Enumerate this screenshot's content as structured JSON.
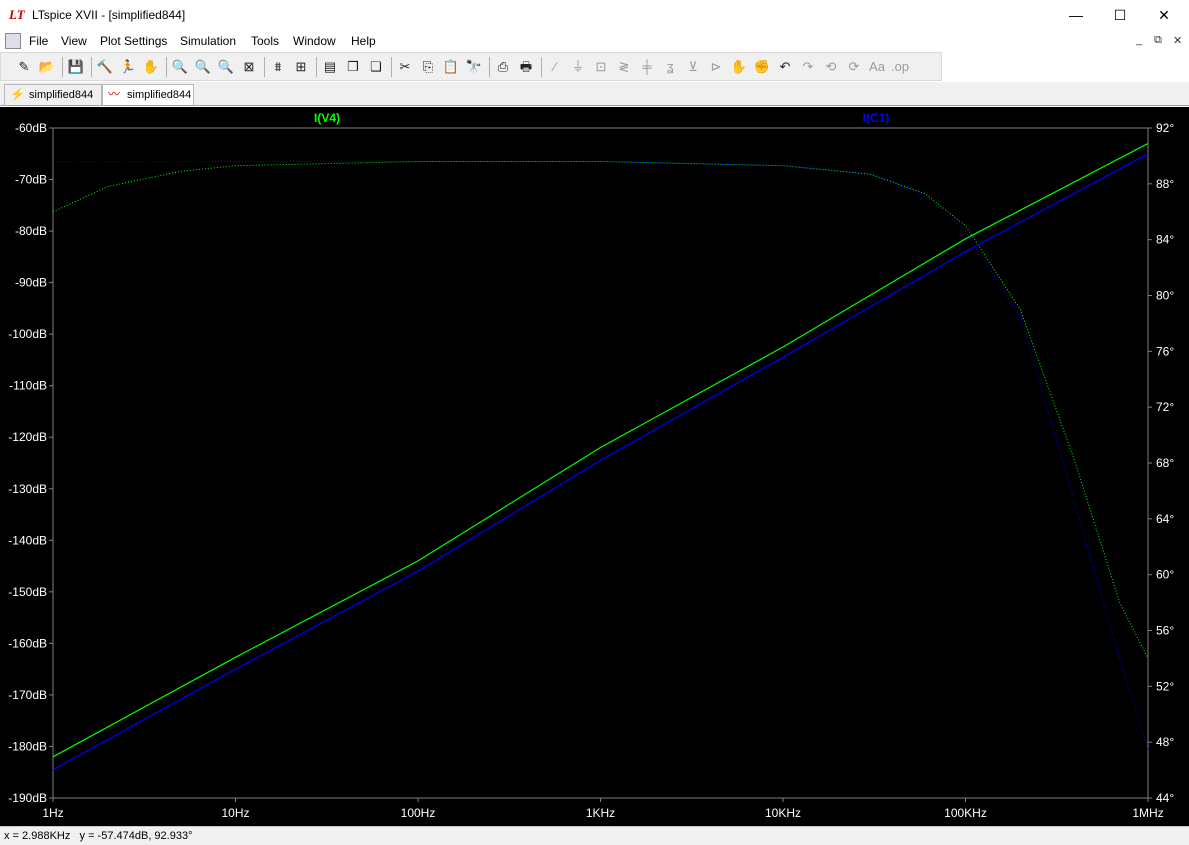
{
  "window": {
    "title": "LTspice XVII - [simplified844]",
    "app_icon": "LT",
    "controls": {
      "minimize": "—",
      "maximize": "☐",
      "close": "✕"
    }
  },
  "menu": {
    "items": [
      "File",
      "View",
      "Plot Settings",
      "Simulation",
      "Tools",
      "Window",
      "Help"
    ],
    "mdi_controls": {
      "minimize": "_",
      "restore": "⧉",
      "close": "✕"
    }
  },
  "toolbar": {
    "buttons": [
      {
        "name": "new-schematic",
        "glyph": "✎",
        "enabled": true
      },
      {
        "name": "open",
        "glyph": "📂",
        "enabled": true
      },
      {
        "name": "save",
        "glyph": "💾",
        "enabled": true
      },
      {
        "name": "control-panel",
        "glyph": "🔨",
        "enabled": true
      },
      {
        "name": "run",
        "glyph": "🏃",
        "enabled": true
      },
      {
        "name": "halt",
        "glyph": "✋",
        "enabled": false
      },
      {
        "name": "zoom-in",
        "glyph": "🔍",
        "enabled": true
      },
      {
        "name": "zoom-pan",
        "glyph": "🔍",
        "enabled": true
      },
      {
        "name": "zoom-out",
        "glyph": "🔍",
        "enabled": true
      },
      {
        "name": "zoom-fit",
        "glyph": "⊠",
        "enabled": true
      },
      {
        "name": "autorange",
        "glyph": "⩩",
        "enabled": true
      },
      {
        "name": "autorange-y",
        "glyph": "⊞",
        "enabled": true
      },
      {
        "name": "tile-horizontal",
        "glyph": "▤",
        "enabled": true
      },
      {
        "name": "cascade",
        "glyph": "❐",
        "enabled": true
      },
      {
        "name": "tile-vertical",
        "glyph": "❑",
        "enabled": true
      },
      {
        "name": "cut",
        "glyph": "✂",
        "enabled": true
      },
      {
        "name": "copy",
        "glyph": "⎘",
        "enabled": true
      },
      {
        "name": "paste",
        "glyph": "📋",
        "enabled": true
      },
      {
        "name": "find",
        "glyph": "🔭",
        "enabled": true
      },
      {
        "name": "print-setup",
        "glyph": "⎙",
        "enabled": true
      },
      {
        "name": "print",
        "glyph": "🖶",
        "enabled": true
      },
      {
        "name": "draw-wire",
        "glyph": "∕",
        "enabled": false
      },
      {
        "name": "ground",
        "glyph": "⏚",
        "enabled": false
      },
      {
        "name": "label-net",
        "glyph": "⊡",
        "enabled": false
      },
      {
        "name": "resistor",
        "glyph": "≷",
        "enabled": false
      },
      {
        "name": "capacitor",
        "glyph": "╪",
        "enabled": false
      },
      {
        "name": "inductor",
        "glyph": "ʓ",
        "enabled": false
      },
      {
        "name": "diode",
        "glyph": "⊻",
        "enabled": false
      },
      {
        "name": "component",
        "glyph": "⊳",
        "enabled": false
      },
      {
        "name": "move",
        "glyph": "✋",
        "enabled": false
      },
      {
        "name": "drag",
        "glyph": "✊",
        "enabled": false
      },
      {
        "name": "undo",
        "glyph": "↶",
        "enabled": true
      },
      {
        "name": "redo",
        "glyph": "↷",
        "enabled": false
      },
      {
        "name": "rotate",
        "glyph": "⟲",
        "enabled": false
      },
      {
        "name": "mirror",
        "glyph": "⟳",
        "enabled": false
      },
      {
        "name": "text",
        "glyph": "Aa",
        "enabled": false
      },
      {
        "name": "spice-directive",
        "glyph": ".op",
        "enabled": false
      }
    ]
  },
  "tabs": [
    {
      "label": "simplified844",
      "icon": "schematic-icon",
      "active": false
    },
    {
      "label": "simplified844",
      "icon": "waveform-icon",
      "active": true
    }
  ],
  "plot": {
    "background": "#000000",
    "axis_color": "#808080",
    "label_color": "#ffffff"
  },
  "chart_data": {
    "type": "line",
    "title": "",
    "xscale": "log",
    "xlim": [
      1,
      1000000
    ],
    "x_ticks": [
      "1Hz",
      "10Hz",
      "100Hz",
      "1KHz",
      "10KHz",
      "100KHz",
      "1MHz"
    ],
    "ylabel_left": "",
    "ylim_left": [
      -190,
      -60
    ],
    "y_ticks_left": [
      "-60dB",
      "-70dB",
      "-80dB",
      "-90dB",
      "-100dB",
      "-110dB",
      "-120dB",
      "-130dB",
      "-140dB",
      "-150dB",
      "-160dB",
      "-170dB",
      "-180dB",
      "-190dB"
    ],
    "ylim_right": [
      44,
      92
    ],
    "y_ticks_right": [
      "92°",
      "88°",
      "84°",
      "80°",
      "76°",
      "72°",
      "68°",
      "64°",
      "60°",
      "56°",
      "52°",
      "48°",
      "44°"
    ],
    "grid": false,
    "series": [
      {
        "name": "I(V4)",
        "color": "#00ff00",
        "magnitude_db": [
          [
            1,
            -182
          ],
          [
            10,
            -162.7
          ],
          [
            100,
            -144
          ],
          [
            1000,
            -122
          ],
          [
            10000,
            -102.5
          ],
          [
            100000,
            -81.5
          ],
          [
            1000000,
            -63
          ]
        ],
        "phase_deg": [
          [
            1,
            86.0
          ],
          [
            2,
            87.8
          ],
          [
            5,
            88.9
          ],
          [
            10,
            89.3
          ],
          [
            100,
            89.6
          ],
          [
            1000,
            89.6
          ],
          [
            10000,
            89.3
          ],
          [
            30000,
            88.7
          ],
          [
            60000,
            87.3
          ],
          [
            100000,
            85.0
          ],
          [
            200000,
            79.0
          ],
          [
            400000,
            68.0
          ],
          [
            700000,
            58.0
          ],
          [
            1000000,
            54.0
          ]
        ]
      },
      {
        "name": "I(C1)",
        "color": "#0000ff",
        "magnitude_db": [
          [
            1,
            -184.5
          ],
          [
            10,
            -165
          ],
          [
            100,
            -146
          ],
          [
            1000,
            -124.5
          ],
          [
            10000,
            -104.5
          ],
          [
            100000,
            -84
          ],
          [
            1000000,
            -65
          ]
        ],
        "phase_deg": [
          [
            1,
            89.6
          ],
          [
            10,
            89.6
          ],
          [
            100,
            89.6
          ],
          [
            1000,
            89.6
          ],
          [
            10000,
            89.3
          ],
          [
            30000,
            88.7
          ],
          [
            60000,
            87.2
          ],
          [
            100000,
            84.6
          ],
          [
            200000,
            78.5
          ],
          [
            400000,
            65.0
          ],
          [
            700000,
            54.0
          ],
          [
            1000000,
            47.5
          ]
        ]
      }
    ]
  },
  "status": {
    "cursor_x": "x = 2.988KHz",
    "cursor_y": "y = -57.474dB, 92.933°"
  }
}
